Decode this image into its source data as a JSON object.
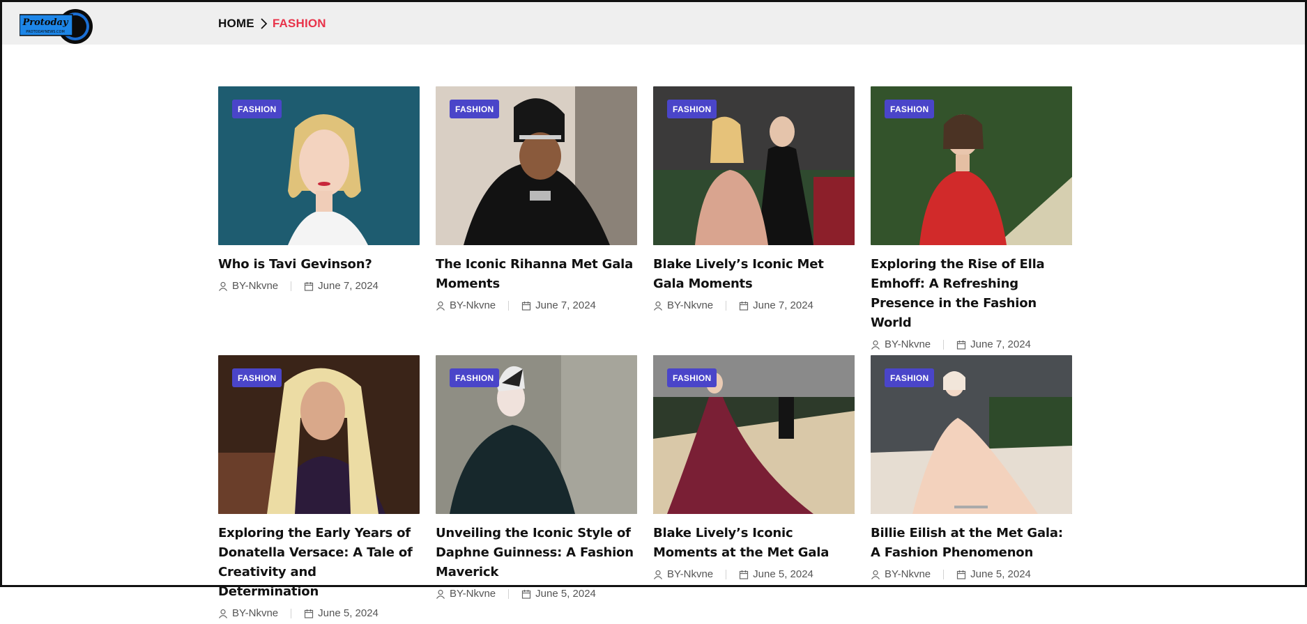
{
  "brand": {
    "logo_text": "Protoday",
    "logo_subtext": "PROTODAYNEWS.COM"
  },
  "breadcrumb": {
    "home": "HOME",
    "current": "FASHION"
  },
  "posts": [
    {
      "category": "FASHION",
      "title": "Who is Tavi Gevinson?",
      "author": "BY-Nkvne",
      "date": "June 7, 2024"
    },
    {
      "category": "FASHION",
      "title": "The Iconic Rihanna Met Gala Moments",
      "author": "BY-Nkvne",
      "date": "June 7, 2024"
    },
    {
      "category": "FASHION",
      "title": "Blake Lively’s Iconic Met Gala Moments",
      "author": "BY-Nkvne",
      "date": "June 7, 2024"
    },
    {
      "category": "FASHION",
      "title": "Exploring the Rise of Ella Emhoff: A Refreshing Presence in the Fashion World",
      "author": "BY-Nkvne",
      "date": "June 7, 2024"
    },
    {
      "category": "FASHION",
      "title": "Exploring the Early Years of Donatella Versace: A Tale of Creativity and Determination",
      "author": "BY-Nkvne",
      "date": "June 5, 2024"
    },
    {
      "category": "FASHION",
      "title": "Unveiling the Iconic Style of Daphne Guinness: A Fashion Maverick",
      "author": "BY-Nkvne",
      "date": "June 5, 2024"
    },
    {
      "category": "FASHION",
      "title": "Blake Lively’s Iconic Moments at the Met Gala",
      "author": "BY-Nkvne",
      "date": "June 5, 2024"
    },
    {
      "category": "FASHION",
      "title": "Billie Eilish at the Met Gala: A Fashion Phenomenon",
      "author": "BY-Nkvne",
      "date": "June 5, 2024"
    }
  ],
  "colors": {
    "accent": "#e8334a",
    "badge": "#4a45c9",
    "topbar": "#efefef"
  }
}
